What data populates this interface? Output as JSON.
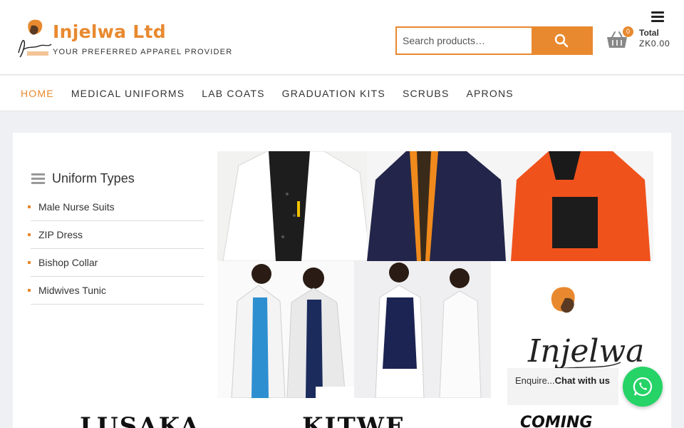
{
  "header": {
    "site_title": "Injelwa Ltd",
    "tagline": "YOUR PREFERRED APPAREL PROVIDER",
    "logo_text": "Injelwa",
    "search": {
      "placeholder": "Search products…",
      "button_icon": "search-icon"
    },
    "cart": {
      "count": "0",
      "total_label": "Total",
      "total_value": "ZK0.00",
      "icon": "basket-icon"
    },
    "menu_icon": "hamburger-icon"
  },
  "nav": {
    "items": [
      {
        "label": "HOME",
        "active": true
      },
      {
        "label": "MEDICAL UNIFORMS"
      },
      {
        "label": "LAB COATS"
      },
      {
        "label": "GRADUATION KITS"
      },
      {
        "label": "SCRUBS"
      },
      {
        "label": "APRONS"
      }
    ]
  },
  "sidebar": {
    "title": "Uniform Types",
    "items": [
      {
        "label": "Male Nurse Suits"
      },
      {
        "label": "ZIP Dress"
      },
      {
        "label": "Bishop Collar"
      },
      {
        "label": "Midwives Tunic"
      }
    ]
  },
  "hero": {
    "logo_text": "Injelwa"
  },
  "cities": {
    "a": "LUSAKA",
    "b": "KITWE",
    "c": "COMING"
  },
  "whatsapp": {
    "prefix": "Enquire...",
    "bold": "Chat with us"
  },
  "colors": {
    "accent": "#e8892f",
    "whatsapp": "#25d366"
  }
}
